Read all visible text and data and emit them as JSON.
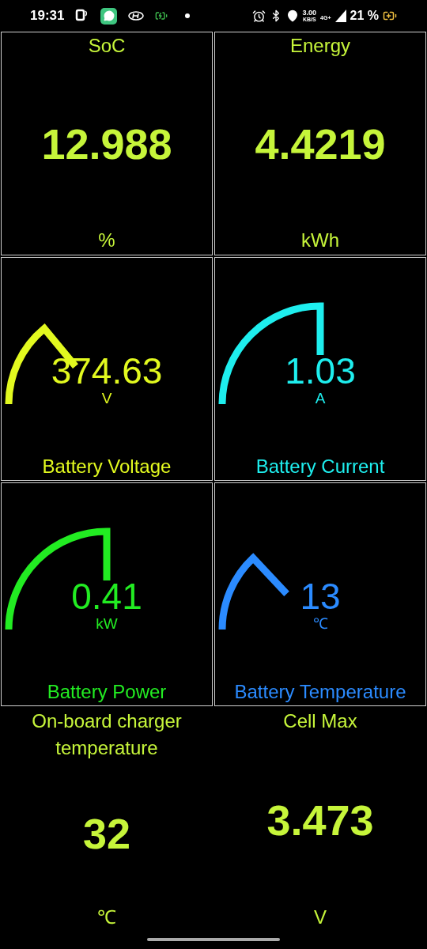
{
  "status_bar": {
    "time": "19:31",
    "speed_value": "3.00",
    "speed_unit": "KB/S",
    "network": "4G+",
    "battery": "21 %"
  },
  "tiles": [
    {
      "kind": "number",
      "title": "SoC",
      "value": "12.988",
      "unit": "%",
      "color": "#c6f53a",
      "framed": true
    },
    {
      "kind": "number",
      "title": "Energy",
      "value": "4.4219",
      "unit": "kWh",
      "color": "#c6f53a",
      "framed": true
    },
    {
      "kind": "gauge",
      "title": "Battery Voltage",
      "value": "374.63",
      "unit": "V",
      "color": "#e2f91f",
      "framed": true
    },
    {
      "kind": "gauge",
      "title": "Battery Current",
      "value": "1.03",
      "unit": "A",
      "color": "#1eeeee",
      "framed": true
    },
    {
      "kind": "gauge",
      "title": "Battery Power",
      "value": "0.41",
      "unit": "kW",
      "color": "#22ec22",
      "framed": true
    },
    {
      "kind": "gauge",
      "title": "Battery Temperature",
      "value": "13",
      "unit": "℃",
      "color": "#2b8bff",
      "framed": true
    },
    {
      "kind": "number",
      "title": "On-board charger temperature",
      "value": "32",
      "unit": "℃",
      "color": "#c6f53a",
      "framed": false
    },
    {
      "kind": "number",
      "title": "Cell Max",
      "value": "3.473",
      "unit": "V",
      "color": "#c6f53a",
      "framed": false
    }
  ]
}
